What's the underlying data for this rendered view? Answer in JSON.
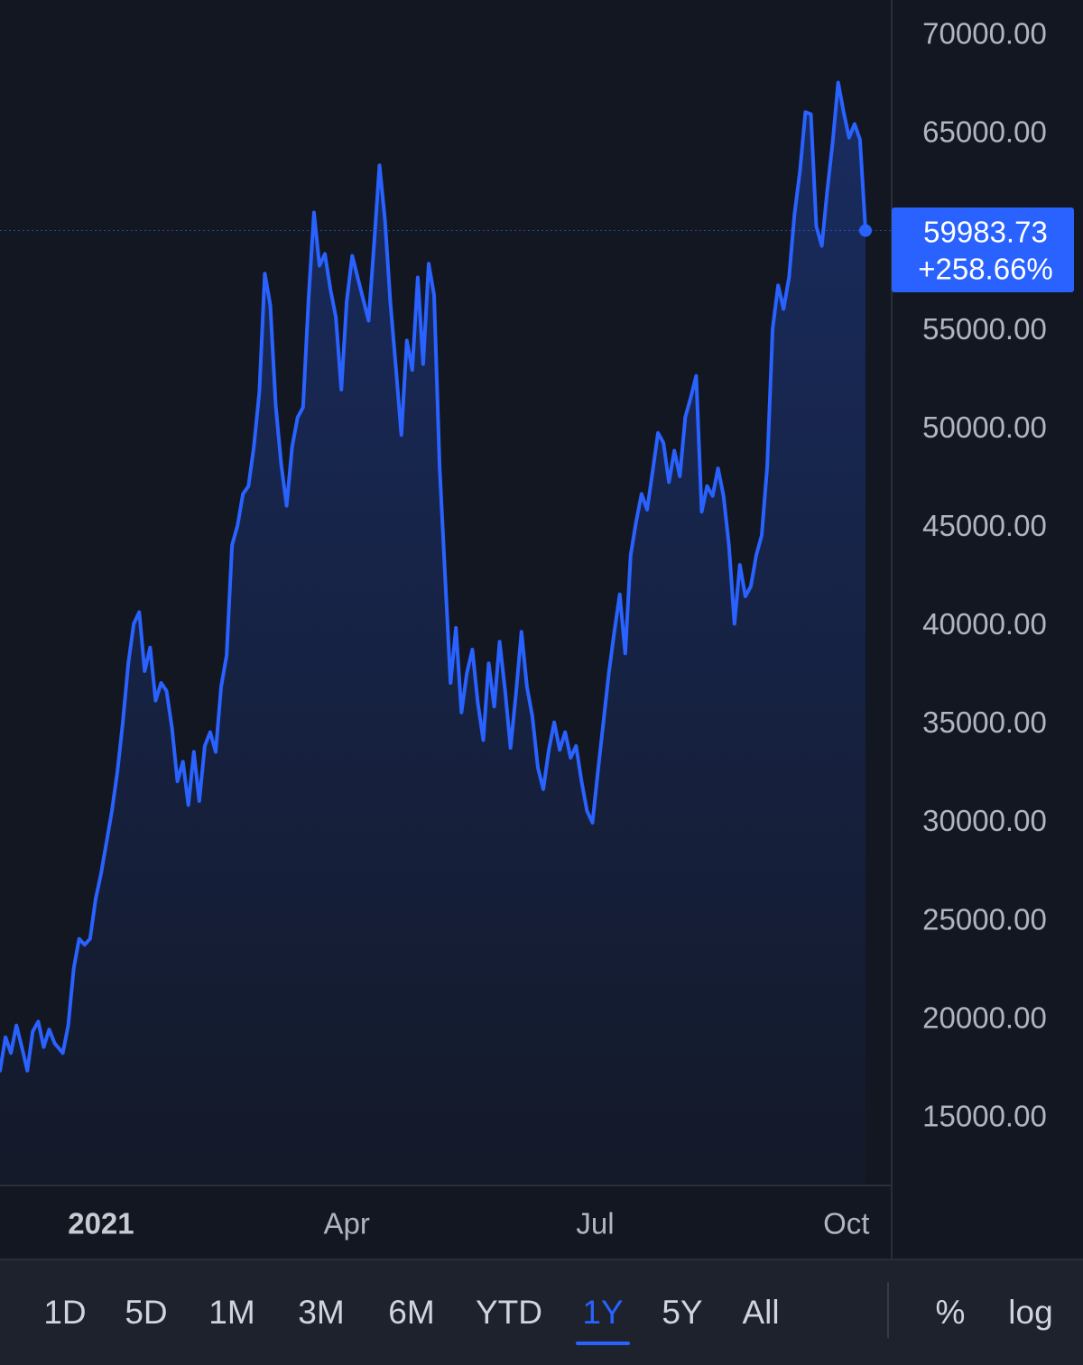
{
  "chart_data": {
    "type": "area",
    "ylim": [
      11000,
      71000
    ],
    "y_ticks": [
      70000,
      65000,
      60000,
      55000,
      50000,
      45000,
      40000,
      35000,
      30000,
      25000,
      20000,
      15000
    ],
    "y_tick_labels": [
      "70000.00",
      "65000.00",
      "60000.00",
      "55000.00",
      "50000.00",
      "45000.00",
      "40000.00",
      "35000.00",
      "30000.00",
      "25000.00",
      "20000.00",
      "15000.00"
    ],
    "x_tick_labels": [
      {
        "label": "2021",
        "date": "2021-01-01",
        "bold": true
      },
      {
        "label": "Apr",
        "date": "2021-04-01",
        "bold": false
      },
      {
        "label": "Jul",
        "date": "2021-07-01",
        "bold": false
      },
      {
        "label": "Oct",
        "date": "2021-10-01",
        "bold": false
      }
    ],
    "x_start": "2020-11-25",
    "x_end": "2021-11-30",
    "grid": false,
    "last_value": {
      "value": 59983.73,
      "label": "59983.73",
      "change": "+258.66%"
    },
    "series": [
      {
        "values": [
          [
            "2020-11-25",
            17300
          ],
          [
            "2020-11-27",
            19000
          ],
          [
            "2020-11-29",
            18200
          ],
          [
            "2020-12-01",
            19600
          ],
          [
            "2020-12-03",
            18500
          ],
          [
            "2020-12-05",
            17300
          ],
          [
            "2020-12-07",
            19300
          ],
          [
            "2020-12-09",
            19800
          ],
          [
            "2020-12-11",
            18500
          ],
          [
            "2020-12-13",
            19400
          ],
          [
            "2020-12-15",
            18700
          ],
          [
            "2020-12-18",
            18200
          ],
          [
            "2020-12-20",
            19600
          ],
          [
            "2020-12-22",
            22500
          ],
          [
            "2020-12-24",
            24000
          ],
          [
            "2020-12-26",
            23700
          ],
          [
            "2020-12-28",
            24000
          ],
          [
            "2020-12-30",
            26000
          ],
          [
            "2021-01-01",
            27300
          ],
          [
            "2021-01-03",
            28900
          ],
          [
            "2021-01-05",
            30500
          ],
          [
            "2021-01-07",
            32500
          ],
          [
            "2021-01-09",
            35000
          ],
          [
            "2021-01-11",
            38000
          ],
          [
            "2021-01-13",
            40000
          ],
          [
            "2021-01-15",
            40600
          ],
          [
            "2021-01-17",
            37600
          ],
          [
            "2021-01-19",
            38800
          ],
          [
            "2021-01-21",
            36100
          ],
          [
            "2021-01-23",
            37000
          ],
          [
            "2021-01-25",
            36600
          ],
          [
            "2021-01-27",
            34700
          ],
          [
            "2021-01-29",
            32000
          ],
          [
            "2021-01-31",
            33000
          ],
          [
            "2021-02-02",
            30800
          ],
          [
            "2021-02-04",
            33500
          ],
          [
            "2021-02-06",
            31000
          ],
          [
            "2021-02-08",
            33800
          ],
          [
            "2021-02-10",
            34500
          ],
          [
            "2021-02-12",
            33500
          ],
          [
            "2021-02-14",
            36800
          ],
          [
            "2021-02-16",
            38400
          ],
          [
            "2021-02-18",
            44000
          ],
          [
            "2021-02-20",
            45000
          ],
          [
            "2021-02-22",
            46600
          ],
          [
            "2021-02-24",
            47000
          ],
          [
            "2021-02-26",
            49000
          ],
          [
            "2021-02-28",
            51800
          ],
          [
            "2021-03-02",
            57800
          ],
          [
            "2021-03-04",
            56200
          ],
          [
            "2021-03-06",
            51100
          ],
          [
            "2021-03-08",
            48100
          ],
          [
            "2021-03-10",
            46000
          ],
          [
            "2021-03-12",
            49000
          ],
          [
            "2021-03-14",
            50500
          ],
          [
            "2021-03-16",
            51000
          ],
          [
            "2021-03-18",
            56500
          ],
          [
            "2021-03-20",
            60900
          ],
          [
            "2021-03-22",
            58200
          ],
          [
            "2021-03-24",
            58800
          ],
          [
            "2021-03-26",
            57000
          ],
          [
            "2021-03-28",
            55600
          ],
          [
            "2021-03-30",
            51900
          ],
          [
            "2021-04-01",
            56400
          ],
          [
            "2021-04-03",
            58700
          ],
          [
            "2021-04-05",
            57600
          ],
          [
            "2021-04-07",
            56500
          ],
          [
            "2021-04-09",
            55400
          ],
          [
            "2021-04-11",
            59300
          ],
          [
            "2021-04-13",
            63300
          ],
          [
            "2021-04-15",
            60500
          ],
          [
            "2021-04-17",
            56300
          ],
          [
            "2021-04-19",
            53000
          ],
          [
            "2021-04-21",
            49600
          ],
          [
            "2021-04-23",
            54400
          ],
          [
            "2021-04-25",
            52900
          ],
          [
            "2021-04-27",
            57600
          ],
          [
            "2021-04-29",
            53200
          ],
          [
            "2021-05-01",
            58300
          ],
          [
            "2021-05-03",
            56700
          ],
          [
            "2021-05-05",
            48000
          ],
          [
            "2021-05-07",
            42500
          ],
          [
            "2021-05-09",
            37000
          ],
          [
            "2021-05-11",
            39800
          ],
          [
            "2021-05-13",
            35500
          ],
          [
            "2021-05-15",
            37500
          ],
          [
            "2021-05-17",
            38700
          ],
          [
            "2021-05-19",
            36000
          ],
          [
            "2021-05-21",
            34100
          ],
          [
            "2021-05-23",
            38000
          ],
          [
            "2021-05-25",
            35800
          ],
          [
            "2021-05-27",
            39100
          ],
          [
            "2021-05-29",
            36600
          ],
          [
            "2021-05-31",
            33700
          ],
          [
            "2021-06-02",
            36500
          ],
          [
            "2021-06-04",
            39600
          ],
          [
            "2021-06-06",
            36800
          ],
          [
            "2021-06-08",
            35300
          ],
          [
            "2021-06-10",
            32700
          ],
          [
            "2021-06-12",
            31600
          ],
          [
            "2021-06-14",
            33600
          ],
          [
            "2021-06-16",
            35000
          ],
          [
            "2021-06-18",
            33600
          ],
          [
            "2021-06-20",
            34500
          ],
          [
            "2021-06-22",
            33200
          ],
          [
            "2021-06-24",
            33800
          ],
          [
            "2021-06-26",
            32000
          ],
          [
            "2021-06-28",
            30500
          ],
          [
            "2021-06-30",
            29900
          ],
          [
            "2021-07-02",
            32500
          ],
          [
            "2021-07-04",
            35000
          ],
          [
            "2021-07-06",
            37500
          ],
          [
            "2021-07-08",
            39600
          ],
          [
            "2021-07-10",
            41500
          ],
          [
            "2021-07-12",
            38500
          ],
          [
            "2021-07-14",
            43500
          ],
          [
            "2021-07-16",
            45200
          ],
          [
            "2021-07-18",
            46600
          ],
          [
            "2021-07-20",
            45800
          ],
          [
            "2021-07-22",
            47700
          ],
          [
            "2021-07-24",
            49700
          ],
          [
            "2021-07-26",
            49200
          ],
          [
            "2021-07-28",
            47200
          ],
          [
            "2021-07-30",
            48800
          ],
          [
            "2021-08-01",
            47500
          ],
          [
            "2021-08-03",
            50500
          ],
          [
            "2021-08-05",
            51500
          ],
          [
            "2021-08-07",
            52600
          ],
          [
            "2021-08-09",
            45700
          ],
          [
            "2021-08-11",
            47000
          ],
          [
            "2021-08-13",
            46500
          ],
          [
            "2021-08-15",
            47900
          ],
          [
            "2021-08-17",
            46500
          ],
          [
            "2021-08-19",
            44000
          ],
          [
            "2021-08-21",
            40000
          ],
          [
            "2021-08-23",
            43000
          ],
          [
            "2021-08-25",
            41400
          ],
          [
            "2021-08-27",
            41900
          ],
          [
            "2021-08-29",
            43500
          ],
          [
            "2021-08-31",
            44500
          ],
          [
            "2021-09-02",
            48000
          ],
          [
            "2021-09-04",
            55000
          ],
          [
            "2021-09-06",
            57200
          ],
          [
            "2021-09-08",
            56000
          ],
          [
            "2021-09-10",
            57600
          ],
          [
            "2021-09-12",
            60800
          ],
          [
            "2021-09-14",
            63000
          ],
          [
            "2021-09-16",
            66000
          ],
          [
            "2021-09-18",
            65900
          ],
          [
            "2021-09-20",
            60200
          ],
          [
            "2021-09-22",
            59200
          ],
          [
            "2021-09-24",
            62000
          ],
          [
            "2021-09-26",
            64500
          ],
          [
            "2021-09-28",
            67500
          ],
          [
            "2021-09-30",
            66000
          ],
          [
            "2021-10-02",
            64700
          ],
          [
            "2021-10-04",
            65400
          ],
          [
            "2021-10-06",
            64600
          ],
          [
            "2021-10-08",
            59983.73
          ]
        ]
      }
    ]
  },
  "toolbar": {
    "ranges": [
      "1D",
      "5D",
      "1M",
      "3M",
      "6M",
      "YTD",
      "1Y",
      "5Y",
      "All"
    ],
    "active_range": "1Y",
    "percent_label": "%",
    "log_label": "log"
  },
  "colors": {
    "background": "#131722",
    "line": "#2962ff",
    "badge": "#2962ff",
    "axis_text": "#b2b5be",
    "active_tab": "#2962ff"
  }
}
